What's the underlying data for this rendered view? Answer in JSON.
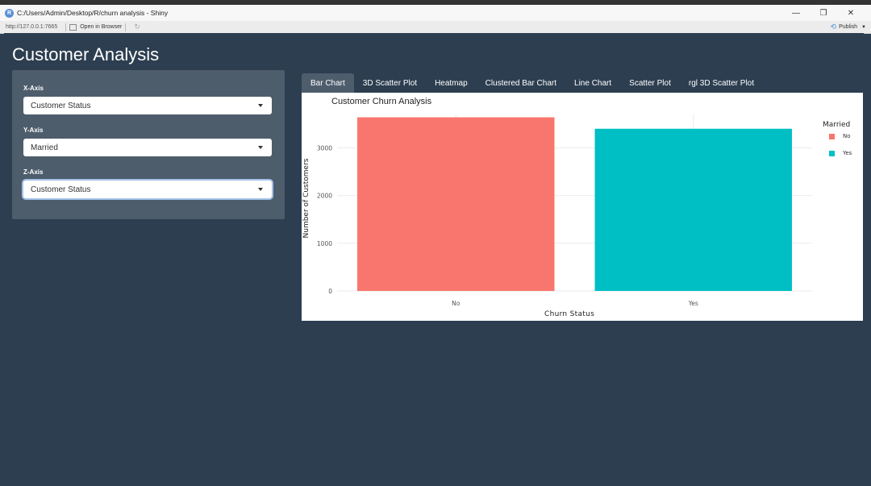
{
  "window": {
    "title": "C:/Users/Admin/Desktop/R/churn analysis - Shiny",
    "url": "http://127.0.0.1:7665",
    "open_in_browser": "Open in Browser",
    "publish": "Publish",
    "minimize_glyph": "—",
    "restore_glyph": "❐",
    "close_glyph": "✕"
  },
  "app": {
    "title": "Customer Analysis"
  },
  "sidebar": {
    "x_axis": {
      "label": "X-Axis",
      "value": "Customer Status"
    },
    "y_axis": {
      "label": "Y-Axis",
      "value": "Married"
    },
    "z_axis": {
      "label": "Z-Axis",
      "value": "Customer Status"
    }
  },
  "tabs": [
    {
      "label": "Bar Chart",
      "active": true
    },
    {
      "label": "3D Scatter Plot",
      "active": false
    },
    {
      "label": "Heatmap",
      "active": false
    },
    {
      "label": "Clustered Bar Chart",
      "active": false
    },
    {
      "label": "Line Chart",
      "active": false
    },
    {
      "label": "Scatter Plot",
      "active": false
    },
    {
      "label": "rgl 3D Scatter Plot",
      "active": false
    }
  ],
  "chart_data": {
    "type": "bar",
    "title": "Customer Churn Analysis",
    "xlabel": "Churn Status",
    "ylabel": "Number of Customers",
    "categories": [
      "No",
      "Yes"
    ],
    "values": [
      3640,
      3400
    ],
    "colors": [
      "#f8766d",
      "#00bfc4"
    ],
    "y_ticks": [
      0,
      1000,
      2000,
      3000
    ],
    "ylim": [
      0,
      3700
    ],
    "grid": true,
    "legend": {
      "title": "Married",
      "position": "right",
      "entries": [
        {
          "label": "No",
          "color": "#f8766d"
        },
        {
          "label": "Yes",
          "color": "#00bfc4"
        }
      ]
    }
  }
}
